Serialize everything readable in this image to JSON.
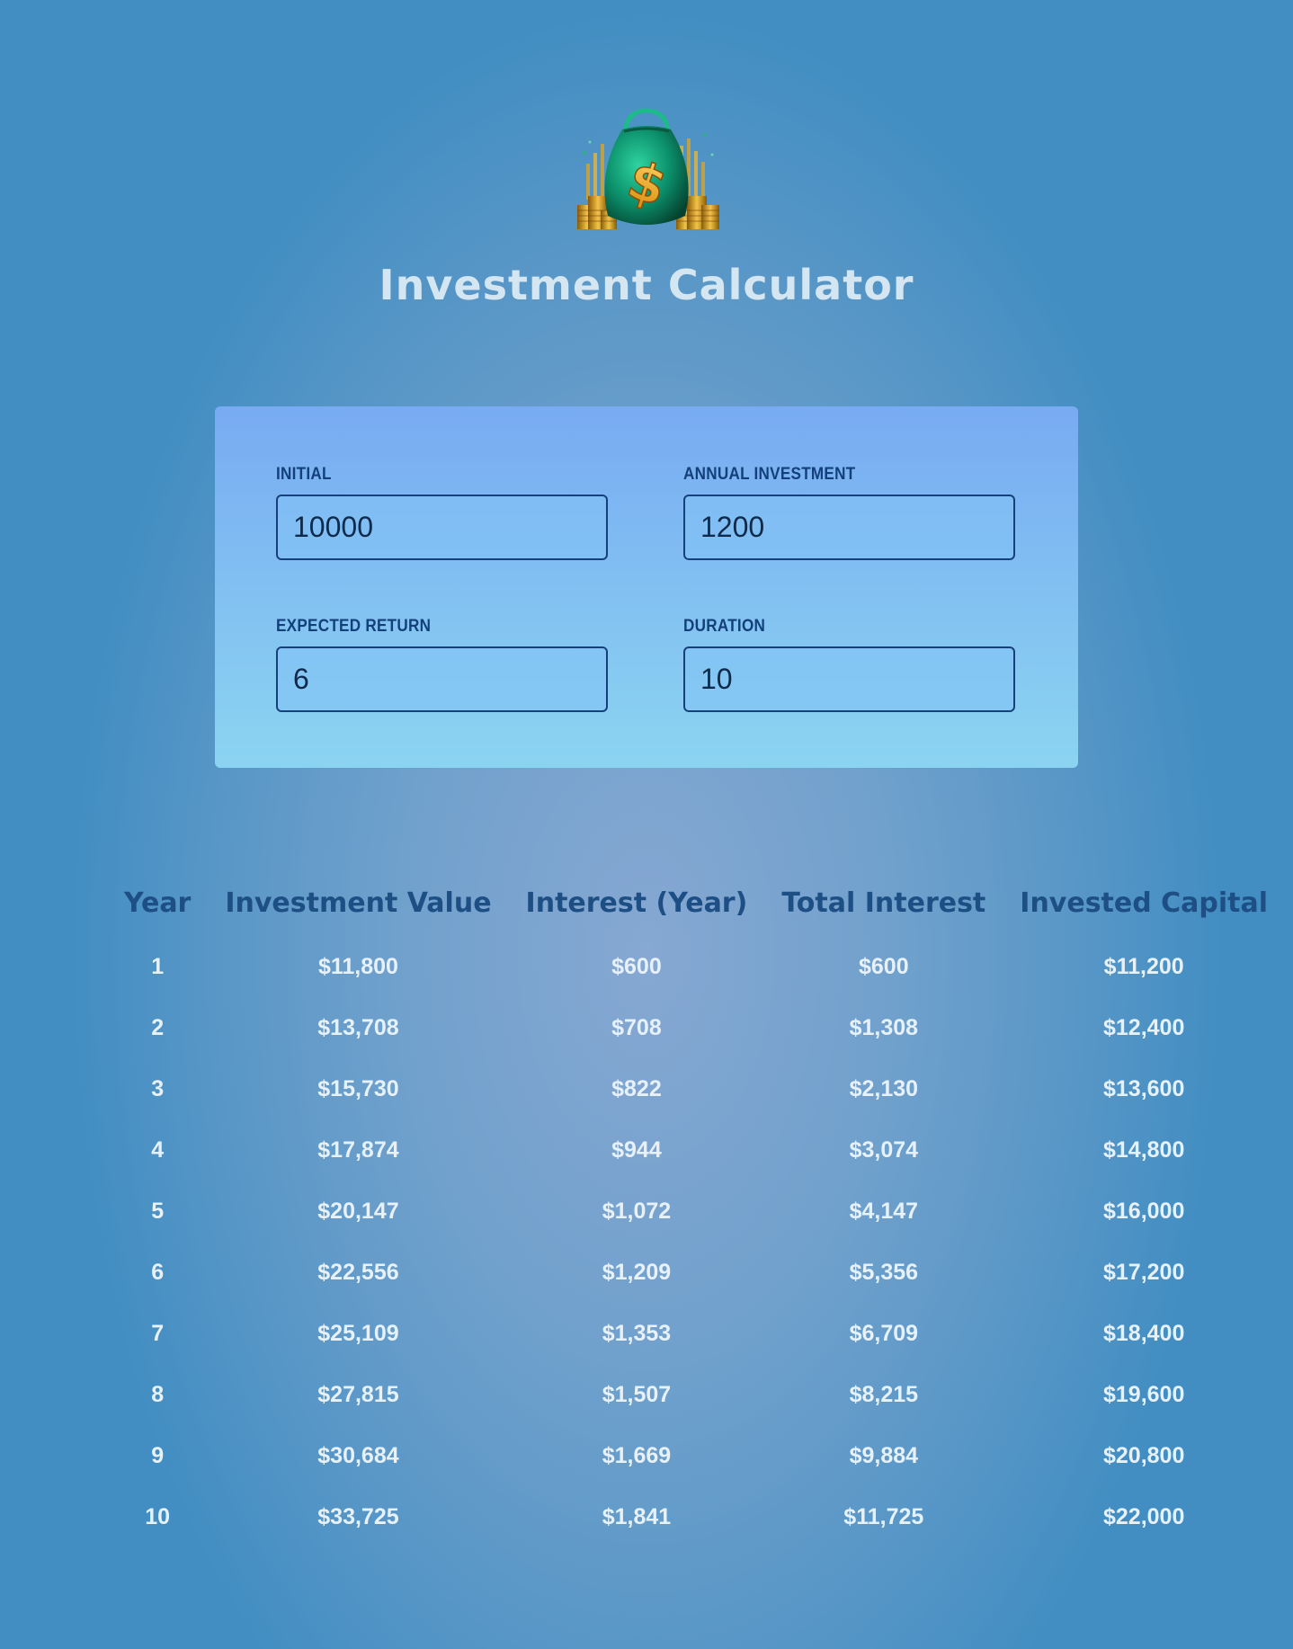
{
  "header": {
    "logo_icon": "money-bag-icon",
    "title": "Investment Calculator"
  },
  "inputs": {
    "initial": {
      "label": "INITIAL",
      "value": "10000"
    },
    "annual_investment": {
      "label": "ANNUAL INVESTMENT",
      "value": "1200"
    },
    "expected_return": {
      "label": "EXPECTED RETURN",
      "value": "6"
    },
    "duration": {
      "label": "DURATION",
      "value": "10"
    }
  },
  "results": {
    "columns": [
      "Year",
      "Investment Value",
      "Interest (Year)",
      "Total Interest",
      "Invested Capital"
    ],
    "rows": [
      [
        "1",
        "$11,800",
        "$600",
        "$600",
        "$11,200"
      ],
      [
        "2",
        "$13,708",
        "$708",
        "$1,308",
        "$12,400"
      ],
      [
        "3",
        "$15,730",
        "$822",
        "$2,130",
        "$13,600"
      ],
      [
        "4",
        "$17,874",
        "$944",
        "$3,074",
        "$14,800"
      ],
      [
        "5",
        "$20,147",
        "$1,072",
        "$4,147",
        "$16,000"
      ],
      [
        "6",
        "$22,556",
        "$1,209",
        "$5,356",
        "$17,200"
      ],
      [
        "7",
        "$25,109",
        "$1,353",
        "$6,709",
        "$18,400"
      ],
      [
        "8",
        "$27,815",
        "$1,507",
        "$8,215",
        "$19,600"
      ],
      [
        "9",
        "$30,684",
        "$1,669",
        "$9,884",
        "$20,800"
      ],
      [
        "10",
        "$33,725",
        "$1,841",
        "$11,725",
        "$22,000"
      ]
    ]
  },
  "colors": {
    "background": "#5495c6",
    "panel_top": "#78abf2",
    "panel_bottom": "#8bd4f1",
    "label": "#13407a",
    "table_header": "#1d4f85",
    "table_cell": "#e7f1f9",
    "title": "#d3e6f1"
  }
}
